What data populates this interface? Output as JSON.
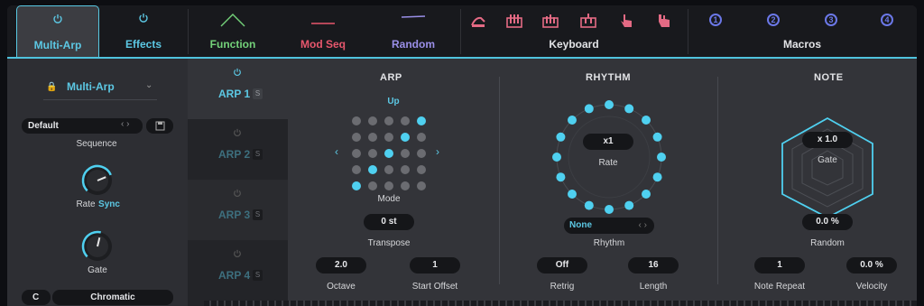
{
  "tabs": [
    {
      "label": "Multi-Arp",
      "active": true,
      "color": "#5cc8e4"
    },
    {
      "label": "Effects",
      "active": false,
      "color": "#5cc8e4"
    },
    {
      "label": "Function",
      "color": "#74d27a"
    },
    {
      "label": "Mod Seq",
      "color": "#e7576d"
    },
    {
      "label": "Random",
      "color": "#9a8fe8"
    },
    {
      "label": "Keyboard",
      "color": "#d9d9dd"
    },
    {
      "label": "Macros",
      "color": "#d9d9dd"
    }
  ],
  "macros": [
    "1",
    "2",
    "3",
    "4"
  ],
  "left": {
    "preset_name": "Multi-Arp",
    "sequence_value": "Default",
    "sequence_label": "Sequence",
    "rate_label": "Rate",
    "sync_label": "Sync",
    "gate_label": "Gate",
    "rate_knob": 0.75,
    "gate_knob": 0.55,
    "key_value": "C",
    "scale_value": "Chromatic"
  },
  "arps": [
    {
      "label": "ARP 1",
      "solo": "S",
      "active": true
    },
    {
      "label": "ARP 2",
      "solo": "S",
      "active": false
    },
    {
      "label": "ARP 3",
      "solo": "S",
      "active": false
    },
    {
      "label": "ARP 4",
      "solo": "S",
      "active": false
    }
  ],
  "arp": {
    "title": "ARP",
    "direction": "Up",
    "mode_label": "Mode",
    "transpose_value": "0 st",
    "transpose_label": "Transpose",
    "octave_value": "2.0",
    "octave_label": "Octave",
    "start_offset_value": "1",
    "start_offset_label": "Start Offset",
    "grid_on": [
      [
        0,
        4
      ],
      [
        1,
        3
      ],
      [
        2,
        2
      ],
      [
        3,
        1
      ],
      [
        4,
        0
      ]
    ]
  },
  "rhythm": {
    "title": "RHYTHM",
    "rate_value": "x1",
    "rate_label": "Rate",
    "rhythm_value": "None",
    "rhythm_label": "Rhythm",
    "retrig_value": "Off",
    "retrig_label": "Retrig",
    "length_value": "16",
    "length_label": "Length",
    "steps": 16
  },
  "note": {
    "title": "NOTE",
    "gate_value": "x 1.0",
    "gate_label": "Gate",
    "random_value": "0.0 %",
    "random_label": "Random",
    "repeat_value": "1",
    "repeat_label": "Note Repeat",
    "velocity_value": "0.0 %",
    "velocity_label": "Velocity"
  },
  "colors": {
    "accent": "#4fd0f0"
  }
}
